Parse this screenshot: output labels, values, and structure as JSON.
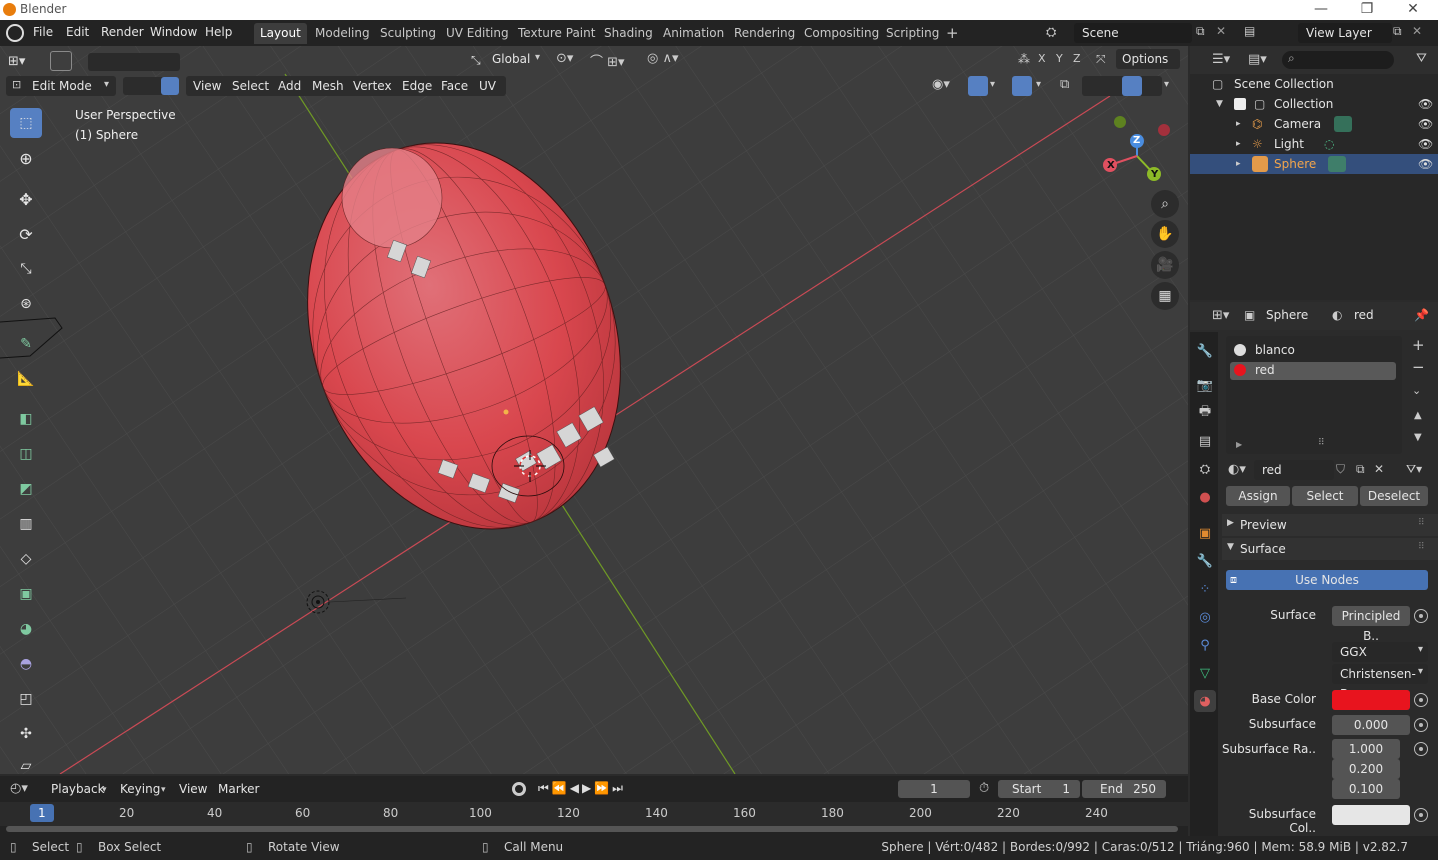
{
  "window": {
    "title": "Blender"
  },
  "menu": [
    "File",
    "Edit",
    "Render",
    "Window",
    "Help"
  ],
  "workspaces": [
    "Layout",
    "Modeling",
    "Sculpting",
    "UV Editing",
    "Texture Paint",
    "Shading",
    "Animation",
    "Rendering",
    "Compositing",
    "Scripting"
  ],
  "scene": {
    "name": "Scene",
    "view_layer": "View Layer"
  },
  "viewport": {
    "transform_orientation": "Global",
    "options_label": "Options",
    "mode": "Edit Mode",
    "header_menus": [
      "View",
      "Select",
      "Add",
      "Mesh",
      "Vertex",
      "Edge",
      "Face",
      "UV"
    ],
    "overlay_line1": "User Perspective",
    "overlay_line2": "(1) Sphere",
    "gizmo": {
      "x": "X",
      "y": "Y",
      "z": "Z"
    },
    "axis_letters": [
      "X",
      "Y",
      "Z"
    ]
  },
  "outliner": {
    "root": "Scene Collection",
    "collection": "Collection",
    "items": [
      {
        "name": "Camera"
      },
      {
        "name": "Light"
      },
      {
        "name": "Sphere"
      }
    ]
  },
  "properties": {
    "object_name": "Sphere",
    "material_name": "red",
    "slots": [
      "blanco",
      "red"
    ],
    "material_field": "red",
    "assign": "Assign",
    "select": "Select",
    "deselect": "Deselect",
    "preview": "Preview",
    "surface_panel": "Surface",
    "use_nodes": "Use Nodes",
    "surface_label": "Surface",
    "surface_value": "Principled B..",
    "distribution": "GGX",
    "subsurface_method": "Christensen-B..",
    "base_color_label": "Base Color",
    "base_color": "#e8141e",
    "subsurface_label": "Subsurface",
    "subsurface_value": "0.000",
    "subsurface_radius_label": "Subsurface Ra..",
    "subsurface_radius": [
      "1.000",
      "0.200",
      "0.100"
    ],
    "subsurface_color_label": "Subsurface Col..",
    "subsurface_color": "#e6e6e6"
  },
  "timeline": {
    "menus": [
      "Playback",
      "Keying",
      "View",
      "Marker"
    ],
    "current_frame": "1",
    "start_label": "Start",
    "start": "1",
    "end_label": "End",
    "end": "250",
    "ticks": [
      "1",
      "20",
      "40",
      "60",
      "80",
      "100",
      "120",
      "140",
      "160",
      "180",
      "200",
      "220",
      "240"
    ]
  },
  "statusbar": {
    "select": "Select",
    "box_select": "Box Select",
    "rotate_view": "Rotate View",
    "call_menu": "Call Menu",
    "stats": "Sphere | Vért:0/482 | Bordes:0/992 | Caras:0/512 | Triáng:960 | Mem: 58.9 MiB | v2.82.7"
  },
  "colors": {
    "accent": "#5680c2",
    "selection": "#344f7c",
    "sphere_red": "#d9474e",
    "x_axis": "#d44e5c",
    "y_axis": "#7fb02a"
  }
}
